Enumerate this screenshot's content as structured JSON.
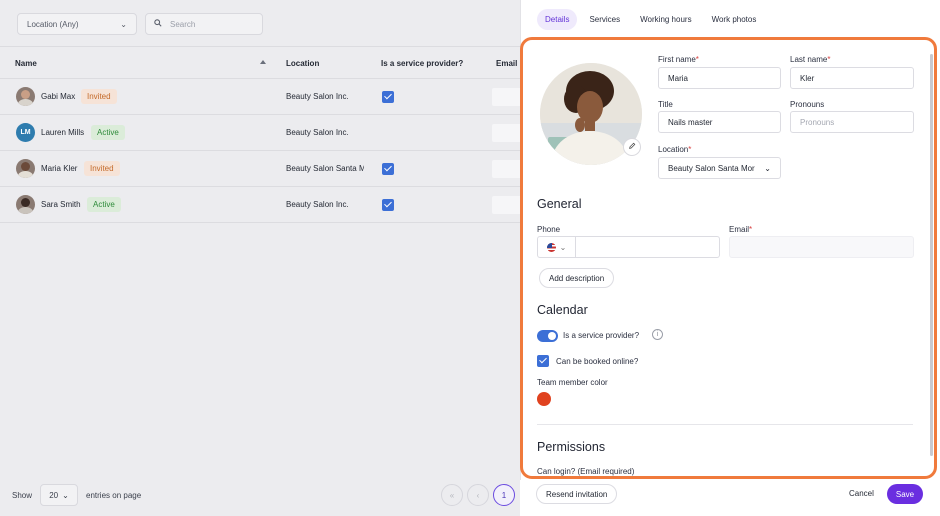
{
  "filters": {
    "location_select": "Location (Any)",
    "search_placeholder": "Search"
  },
  "table": {
    "headers": {
      "name": "Name",
      "location": "Location",
      "service_provider": "Is a service provider?",
      "email": "Email"
    },
    "rows": [
      {
        "name": "Gabi Max",
        "status": "Invited",
        "location": "Beauty Salon Inc.",
        "service_provider": true
      },
      {
        "name": "Lauren Mills",
        "initials": "LM",
        "status": "Active",
        "location": "Beauty Salon Inc.",
        "service_provider": false
      },
      {
        "name": "Maria Kler",
        "status": "Invited",
        "location": "Beauty Salon Santa M",
        "service_provider": true
      },
      {
        "name": "Sara Smith",
        "status": "Active",
        "location": "Beauty Salon Inc.",
        "service_provider": true
      }
    ]
  },
  "footer": {
    "show_label": "Show",
    "page_size": "20",
    "entries_label": "entries on page",
    "prev_first": "«",
    "prev": "‹",
    "current_page": "1"
  },
  "tabs": [
    "Details",
    "Services",
    "Working hours",
    "Work photos"
  ],
  "form": {
    "first_name_label": "First name",
    "first_name_value": "Maria",
    "last_name_label": "Last name",
    "last_name_value": "Kler",
    "title_label": "Title",
    "title_value": "Nails master",
    "pronouns_label": "Pronouns",
    "pronouns_placeholder": "Pronouns",
    "location_label": "Location",
    "location_value": "Beauty Salon Santa Mor",
    "required_mark": "*"
  },
  "general": {
    "heading": "General",
    "phone_label": "Phone",
    "email_label": "Email",
    "add_description": "Add description"
  },
  "calendar": {
    "heading": "Calendar",
    "service_provider_label": "Is a service provider?",
    "service_provider_on": true,
    "booked_online_label": "Can be booked online?",
    "booked_online_checked": true,
    "color_label": "Team member color",
    "color": "#e0421f"
  },
  "permissions": {
    "heading": "Permissions",
    "can_login_label": "Can login? (Email required)"
  },
  "actions": {
    "resend": "Resend invitation",
    "cancel": "Cancel",
    "save": "Save"
  },
  "colors": {
    "accent": "#6a2ee0",
    "highlight_frame": "#f07a3c",
    "checkbox": "#3c6fd6"
  }
}
